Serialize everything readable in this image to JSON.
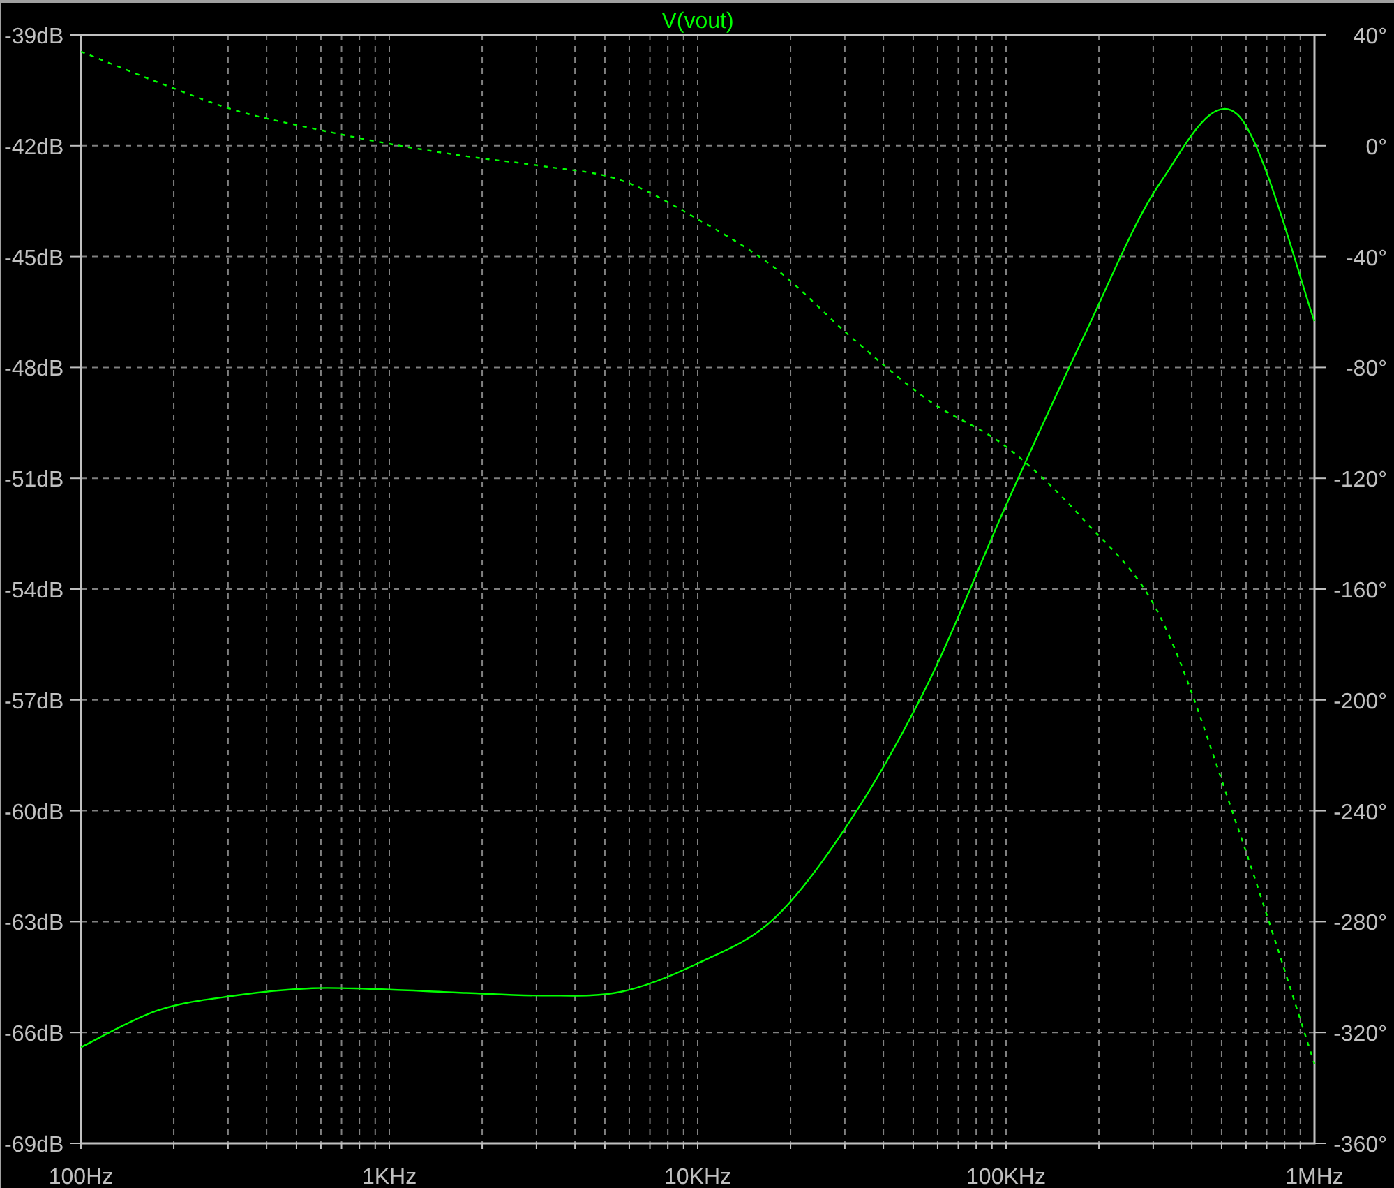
{
  "plot": {
    "magnitude": {
      "chart_data": {
        "type": "line",
        "title": "V(vout)",
        "ylim": [
          -69,
          -39
        ],
        "grid": true,
        "categories": [
          "100Hz",
          null,
          null,
          null,
          "1KHz",
          null,
          null,
          null,
          "10KHz",
          null,
          null,
          null,
          "100KHz",
          null,
          null,
          null,
          "1MHz"
        ],
        "series": [
          {
            "color": "#00ff00",
            "line_style": "solid",
            "values": [
              -66.4,
              -65.4,
              -65.0,
              -64.8,
              -64.84,
              -64.93,
              -65.0,
              -64.9,
              -64.13,
              -62.9,
              -60.2,
              -56.5,
              -51.73,
              -47.2,
              -43.0,
              -41.15,
              -46.75
            ]
          }
        ],
        "yticks": [
          {
            "value": -39,
            "label": "-39dB"
          },
          {
            "value": -42,
            "label": "-42dB"
          },
          {
            "value": -45,
            "label": "-45dB"
          },
          {
            "value": -48,
            "label": "-48dB"
          },
          {
            "value": -51,
            "label": "-51dB"
          },
          {
            "value": -54,
            "label": "-54dB"
          },
          {
            "value": -57,
            "label": "-57dB"
          },
          {
            "value": -60,
            "label": "-60dB"
          },
          {
            "value": -63,
            "label": "-63dB"
          },
          {
            "value": -66,
            "label": "-66dB"
          },
          {
            "value": -69,
            "label": "-69dB"
          }
        ]
      }
    },
    "phase": {
      "chart_data": {
        "type": "line",
        "ylim": [
          -360,
          40
        ],
        "categories": [
          null,
          null,
          null,
          null,
          null,
          null,
          null,
          null,
          null,
          null,
          null,
          null,
          null,
          null,
          null,
          null,
          null
        ],
        "series": [
          {
            "color": "#00ff00",
            "line_style": "dashed",
            "values": [
              34,
              22.9,
              12.8,
              6.3,
              0.7,
              -3.8,
              -7.4,
              -12.4,
              -26.5,
              -44.1,
              -69.3,
              -92,
              -108.6,
              -134.8,
              -170,
              -245.6,
              -331.3
            ]
          }
        ],
        "yticks": [
          {
            "value": 40,
            "label": "40°"
          },
          {
            "value": 0,
            "label": "0°"
          },
          {
            "value": -40,
            "label": "-40°"
          },
          {
            "value": -80,
            "label": "-80°"
          },
          {
            "value": -120,
            "label": "-120°"
          },
          {
            "value": -160,
            "label": "-160°"
          },
          {
            "value": -200,
            "label": "-200°"
          },
          {
            "value": -240,
            "label": "-240°"
          },
          {
            "value": -280,
            "label": "-280°"
          },
          {
            "value": -320,
            "label": "-320°"
          },
          {
            "value": -360,
            "label": "-360°"
          }
        ]
      }
    }
  }
}
